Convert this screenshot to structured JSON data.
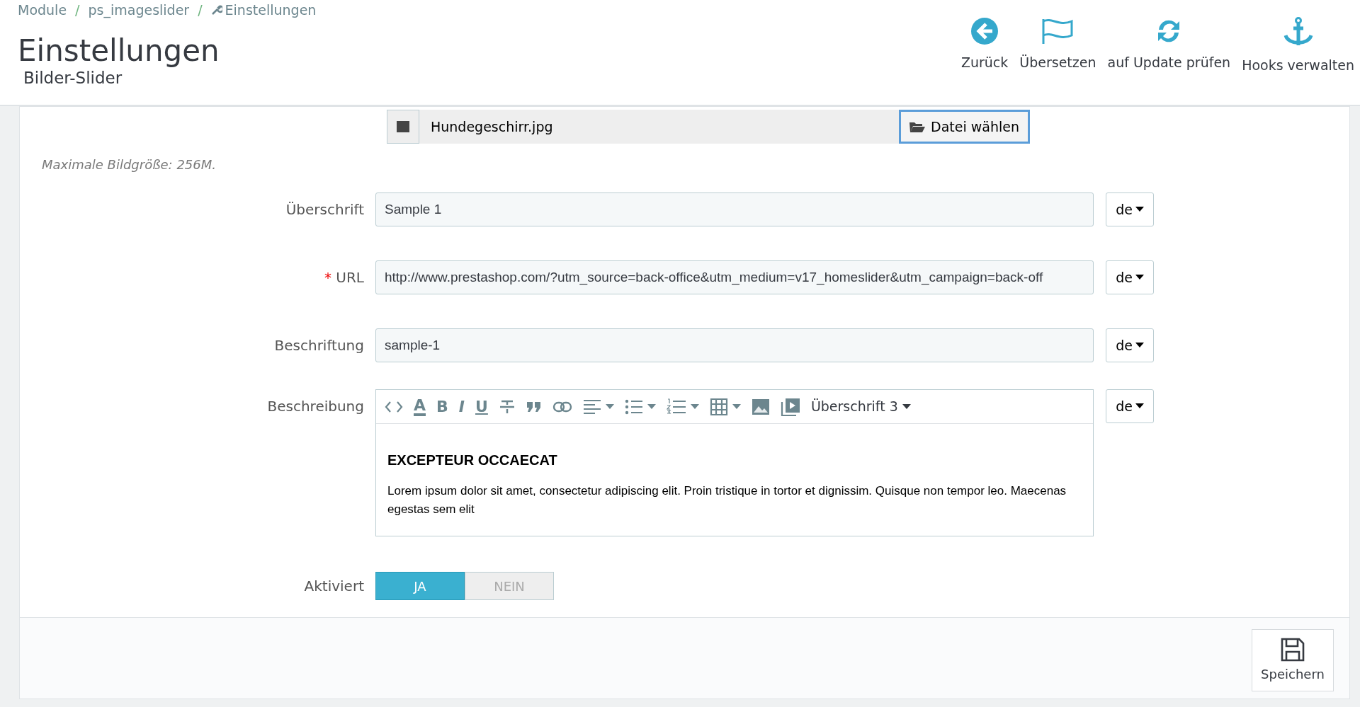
{
  "breadcrumb": [
    {
      "label": "Module",
      "icon": false
    },
    {
      "separator": "/",
      "label": "ps_imageslider",
      "icon": false
    },
    {
      "separator": "/",
      "label": "Einstellungen",
      "icon": true
    }
  ],
  "page": {
    "title": "Einstellungen",
    "subtitle": "Bilder-Slider"
  },
  "toolbar": [
    {
      "label": "Zurück",
      "kind": "back"
    },
    {
      "label": "Übersetzen",
      "kind": "flag"
    },
    {
      "label": "auf Update prüfen",
      "kind": "refresh"
    },
    {
      "label": "Hooks verwalten",
      "kind": "anchor"
    }
  ],
  "file": {
    "value": "Hundegeschirr.jpg",
    "button": "Datei wählen",
    "hint": "Maximale Bildgröße: 256M."
  },
  "fields": [
    {
      "label": "Überschrift",
      "value": "Sample 1",
      "lang": "de"
    },
    {
      "label": "URL",
      "required_mark": "*",
      "value": "http://www.prestashop.com/?utm_source=back-office&utm_medium=v17_homeslider&utm_campaign=back-off",
      "lang": "de"
    },
    {
      "label": "Beschriftung",
      "value": "sample-1",
      "lang": "de"
    }
  ],
  "description": {
    "label": "Beschreibung",
    "lang": "de",
    "tools": [
      {
        "kind": "code",
        "dropdown": false
      },
      {
        "kind": "glyph",
        "glyph": "A",
        "underline_bar": true,
        "dropdown": false
      },
      {
        "kind": "glyph",
        "glyph": "B",
        "dropdown": false
      },
      {
        "kind": "glyph",
        "glyph": "I",
        "dropdown": false
      },
      {
        "kind": "glyph",
        "glyph": "U",
        "underline_bar": false,
        "dropdown": false
      },
      {
        "kind": "strike",
        "dropdown": false
      },
      {
        "kind": "quote",
        "dropdown": false
      },
      {
        "kind": "link",
        "dropdown": false
      },
      {
        "kind": "align",
        "dropdown": true
      },
      {
        "kind": "bullets",
        "dropdown": true
      },
      {
        "kind": "numbers",
        "dropdown": true
      },
      {
        "kind": "table",
        "dropdown": true
      },
      {
        "kind": "image",
        "dropdown": false
      },
      {
        "kind": "video",
        "dropdown": false
      }
    ],
    "style_menu": "Überschrift 3",
    "heading": "EXCEPTEUR OCCAECAT",
    "body": "Lorem ipsum dolor sit amet, consectetur adipiscing elit. Proin tristique in tortor et dignissim. Quisque non tempor leo. Maecenas egestas sem elit"
  },
  "active": {
    "label": "Aktiviert",
    "options": [
      {
        "label": "JA",
        "selected": true
      },
      {
        "label": "NEIN",
        "selected": false
      }
    ]
  },
  "save": {
    "label": "Speichern"
  }
}
